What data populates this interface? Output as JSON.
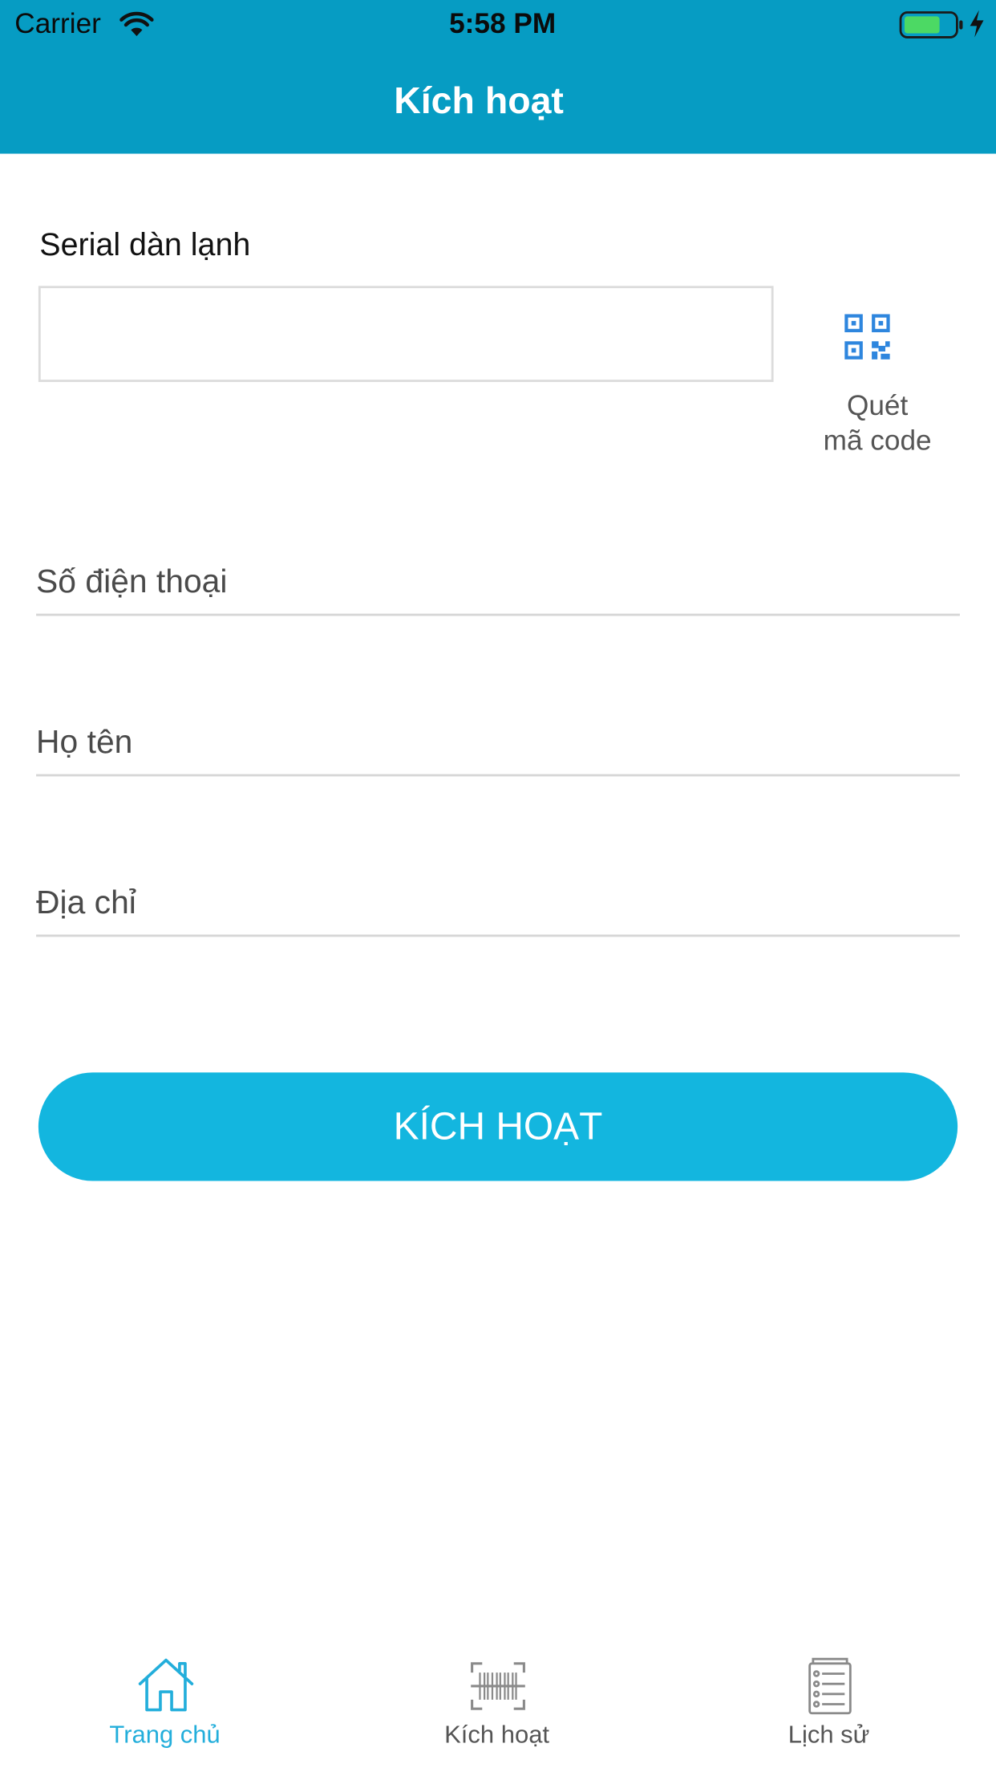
{
  "status_bar": {
    "carrier": "Carrier",
    "time": "5:58 PM",
    "battery_color": "#4cd964"
  },
  "header": {
    "title": "Kích hoạt",
    "background": "#069cc3"
  },
  "form": {
    "serial_label": "Serial dàn lạnh",
    "serial_value": "",
    "scan_label_line1": "Quét",
    "scan_label_line2": "mã code",
    "phone_placeholder": "Số điện thoại",
    "name_placeholder": "Họ tên",
    "address_placeholder": "Địa chỉ",
    "submit_label": "KÍCH HOẠT",
    "submit_color": "#13b6df"
  },
  "tab_bar": {
    "active_color": "#23aedb",
    "items": [
      {
        "label": "Trang chủ",
        "icon": "home-icon",
        "active": true
      },
      {
        "label": "Kích hoạt",
        "icon": "barcode-icon",
        "active": false
      },
      {
        "label": "Lịch sử",
        "icon": "history-list-icon",
        "active": false
      }
    ]
  }
}
